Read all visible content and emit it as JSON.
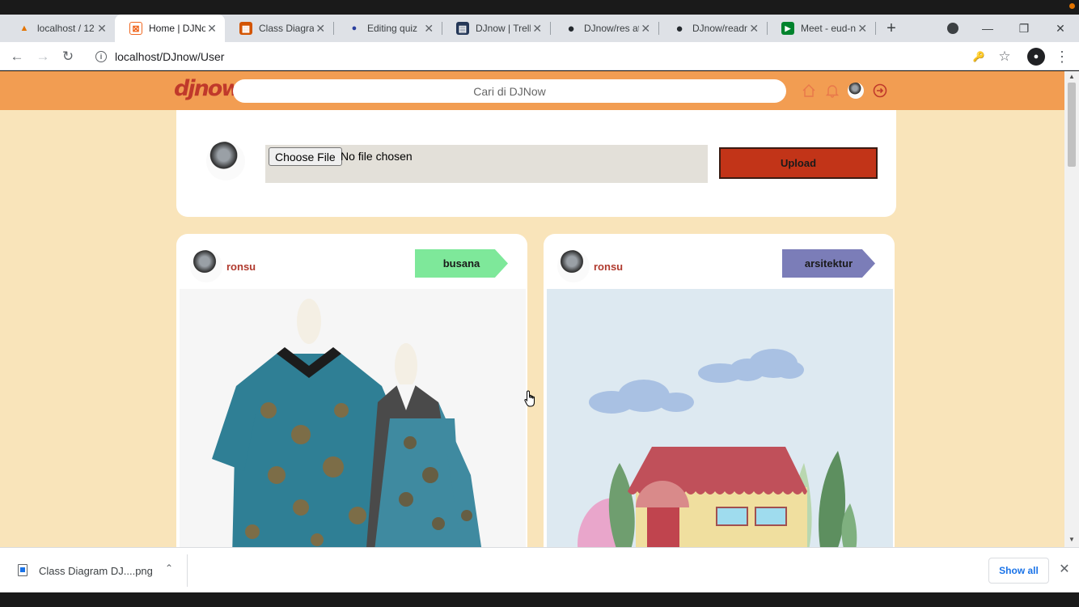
{
  "browser": {
    "tabs": [
      {
        "title": "localhost / 12",
        "favicon_color": "#e37400",
        "favicon_glyph": "▲"
      },
      {
        "title": "Home | DJNow",
        "favicon_color": "#f0661f",
        "favicon_glyph": "⊠"
      },
      {
        "title": "Class Diagram",
        "favicon_color": "#d35400",
        "favicon_glyph": "▦"
      },
      {
        "title": "Editing quiz",
        "favicon_color": "#2a3f9e",
        "favicon_glyph": "●"
      },
      {
        "title": "DJnow | Trello",
        "favicon_color": "#253858",
        "favicon_glyph": "▤"
      },
      {
        "title": "DJnow/res at",
        "favicon_color": "#24292e",
        "favicon_glyph": "●"
      },
      {
        "title": "DJnow/readme",
        "favicon_color": "#24292e",
        "favicon_glyph": "●"
      },
      {
        "title": "Meet - eud-nt",
        "favicon_color": "#00832d",
        "favicon_glyph": "▶"
      }
    ],
    "tab_close_glyph": "✕",
    "new_tab_glyph": "+",
    "url": "localhost/DJnow/User",
    "nav": {
      "back": "←",
      "forward": "→",
      "reload": "↻"
    },
    "toolbar_icons": {
      "key": "🔑",
      "star": "☆",
      "menu": "⋮"
    },
    "window_controls": {
      "minimize": "—",
      "restore": "❐",
      "close": "✕"
    }
  },
  "site": {
    "logo": "djnow",
    "search_placeholder": "Cari di DJNow",
    "brand_color": "#f29d52",
    "accent_color": "#c0392b"
  },
  "upload": {
    "choose_label": "Choose File",
    "file_status": "No file chosen",
    "upload_label": "Upload"
  },
  "posts": [
    {
      "user": "ronsu",
      "tag": "busana",
      "tag_color": "#7ee89a"
    },
    {
      "user": "ronsu",
      "tag": "arsitektur",
      "tag_color": "#7b7db8"
    }
  ],
  "downloads": {
    "file_name": "Class Diagram DJ....png",
    "show_all_label": "Show all",
    "close_glyph": "✕",
    "chevron_glyph": "⌃"
  }
}
